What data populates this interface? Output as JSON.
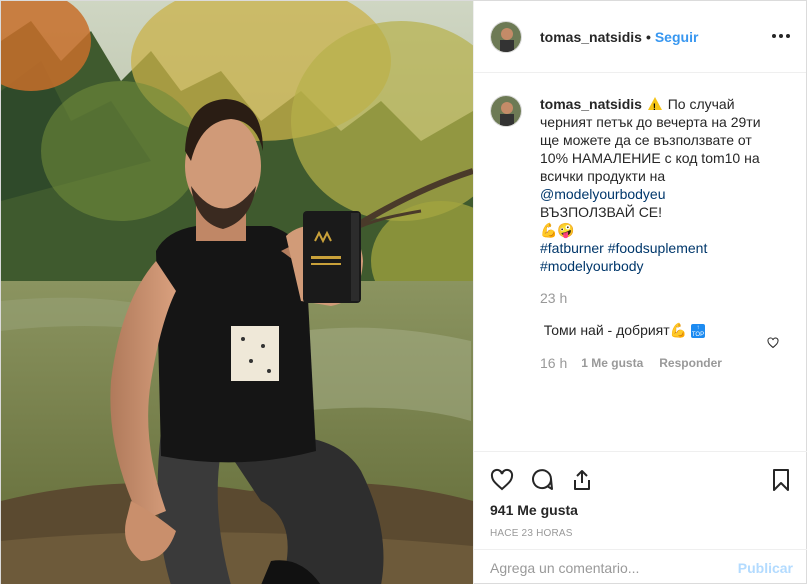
{
  "photo": {
    "alt_icon": "post-photo"
  },
  "header": {
    "username": "tomas_natsidis",
    "separator": "•",
    "follow_label": "Seguir"
  },
  "caption": {
    "username": "tomas_natsidis",
    "text_1": "По случай черният петък до вечерта на 29ти ще можете да се възползвате от 10% НАМАЛЕНИЕ с код tom10 на всички продукти на ",
    "mention": "@modelyourbodyeu",
    "text_2": "ВЪЗПОЛЗВАЙ СЕ!",
    "emojis": "💪🤪",
    "tags": [
      "#fatburner",
      "#foodsuplement",
      "#modelyourbody"
    ],
    "time": "23 h"
  },
  "reply": {
    "text": "Томи най - добрият",
    "emoji": "💪",
    "badge_top": "↑",
    "badge_text": "TOP",
    "time": "16 h",
    "likes": "1 Me gusta",
    "answer": "Responder"
  },
  "actions": {
    "likes": "941 Me gusta",
    "ago": "HACE 23 HORAS"
  },
  "comment_box": {
    "placeholder": "Agrega un comentario...",
    "publish": "Publicar"
  },
  "colors": {
    "link": "#3897f0",
    "tag": "#00376b",
    "muted": "#999999",
    "publish_disabled": "#b3dbff"
  }
}
